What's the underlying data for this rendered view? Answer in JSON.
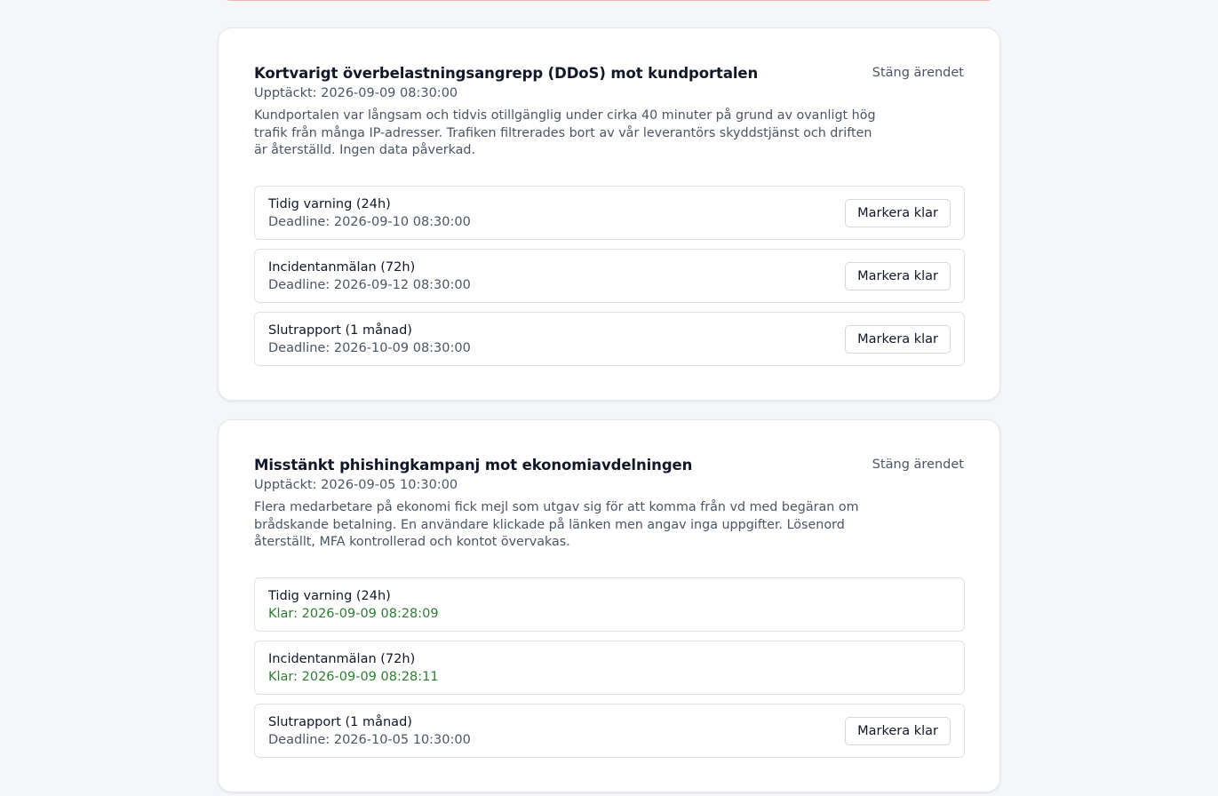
{
  "incidents": [
    {
      "title": "Kortvarigt överbelastningsangrepp (DDoS) mot kundportalen",
      "detected": "Upptäckt: 2026-09-09 08:30:00",
      "description": "Kundportalen var långsam och tidvis otillgänglig under cirka 40 minuter på grund av ovanligt hög trafik från många IP-adresser. Trafiken filtrerades bort av vår leverantörs skyddstjänst och driften är återställd. Ingen data påverkad.",
      "close_label": "Stäng ärendet",
      "steps": [
        {
          "name": "Tidig varning (24h)",
          "status": "Deadline: 2026-09-10 08:30:00",
          "done": false,
          "button": "Markera klar"
        },
        {
          "name": "Incidentanmälan (72h)",
          "status": "Deadline: 2026-09-12 08:30:00",
          "done": false,
          "button": "Markera klar"
        },
        {
          "name": "Slutrapport (1 månad)",
          "status": "Deadline: 2026-10-09 08:30:00",
          "done": false,
          "button": "Markera klar"
        }
      ]
    },
    {
      "title": "Misstänkt phishingkampanj mot ekonomiavdelningen",
      "detected": "Upptäckt: 2026-09-05 10:30:00",
      "description": "Flera medarbetare på ekonomi fick mejl som utgav sig för att komma från vd med begäran om brådskande betalning. En användare klickade på länken men angav inga uppgifter. Lösenord återställt, MFA kontrollerad och kontot övervakas.",
      "close_label": "Stäng ärendet",
      "steps": [
        {
          "name": "Tidig varning (24h)",
          "status": "Klar: 2026-09-09 08:28:09",
          "done": true
        },
        {
          "name": "Incidentanmälan (72h)",
          "status": "Klar: 2026-09-09 08:28:11",
          "done": true
        },
        {
          "name": "Slutrapport (1 månad)",
          "status": "Deadline: 2026-10-05 10:30:00",
          "done": false,
          "button": "Markera klar"
        }
      ]
    }
  ],
  "colors": {
    "done_green": "#2e7d32",
    "muted_text": "#4b5563",
    "background": "#f4f6f8"
  }
}
